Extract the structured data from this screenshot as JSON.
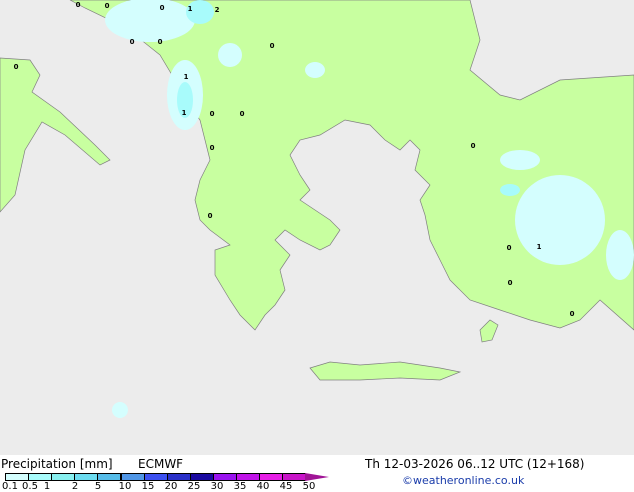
{
  "map": {
    "colors": {
      "sea": "#ececec",
      "land": "#c8ffa0",
      "coast": "#808080",
      "precip_light": "#d4fefe",
      "precip_mid": "#a8fbfb"
    },
    "point_labels": [
      "0",
      "0",
      "0",
      "1",
      "2",
      "0",
      "0",
      "0",
      "1",
      "1",
      "0",
      "0",
      "0",
      "0",
      "0",
      "0",
      "0",
      "1",
      "0",
      "0"
    ]
  },
  "legend": {
    "title": "Precipitation [mm]",
    "model": "ECMWF",
    "datetime": "Th 12-03-2026 06..12 UTC (12+168)",
    "credit": "©weatheronline.co.uk",
    "ticks": [
      "0.1",
      "0.5",
      "1",
      "2",
      "5",
      "10",
      "15",
      "20",
      "25",
      "30",
      "35",
      "40",
      "45",
      "50"
    ],
    "colors": [
      "#d4fefe",
      "#a8fbfb",
      "#88f0f0",
      "#6cdcf0",
      "#56bce8",
      "#5096e6",
      "#3c50f0",
      "#2a30c8",
      "#1a0aa0",
      "#9a14f0",
      "#c014e8",
      "#e61ee6",
      "#c814c8"
    ],
    "arrow_color": "#a01496"
  }
}
